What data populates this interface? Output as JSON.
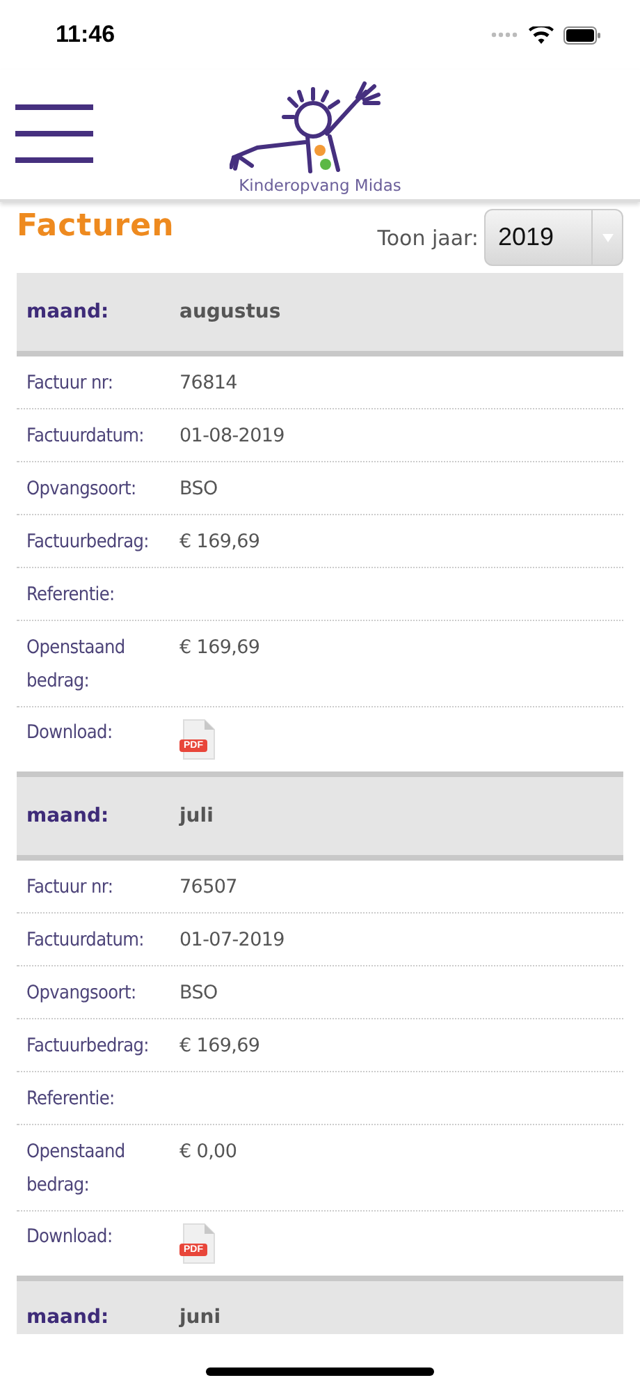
{
  "status_bar": {
    "time": "11:46"
  },
  "header": {
    "logo_text": "Kinderopvang Midas"
  },
  "page": {
    "title": "Facturen",
    "year_label": "Toon jaar:",
    "year": "2019"
  },
  "sections": [
    {
      "month_label": "maand:",
      "month": "augustus",
      "rows": [
        {
          "kind": "text",
          "label": "Factuur nr:",
          "value": "76814"
        },
        {
          "kind": "text",
          "label": "Factuurdatum:",
          "value": "01-08-2019"
        },
        {
          "kind": "text",
          "label": "Opvangsoort:",
          "value": "BSO"
        },
        {
          "kind": "text",
          "label": "Factuurbedrag:",
          "value": "€ 169,69"
        },
        {
          "kind": "text",
          "label": "Referentie:"
        },
        {
          "kind": "text",
          "label": "Openstaand bedrag:",
          "value": "€ 169,69"
        },
        {
          "kind": "pdf",
          "label": "Download:",
          "value": "PDF"
        }
      ]
    },
    {
      "month_label": "maand:",
      "month": "juli",
      "rows": [
        {
          "kind": "text",
          "label": "Factuur nr:",
          "value": "76507"
        },
        {
          "kind": "text",
          "label": "Factuurdatum:",
          "value": "01-07-2019"
        },
        {
          "kind": "text",
          "label": "Opvangsoort:",
          "value": "BSO"
        },
        {
          "kind": "text",
          "label": "Factuurbedrag:",
          "value": "€ 169,69"
        },
        {
          "kind": "text",
          "label": "Referentie:"
        },
        {
          "kind": "text",
          "label": "Openstaand bedrag:",
          "value": "€ 0,00"
        },
        {
          "kind": "pdf",
          "label": "Download:",
          "value": "PDF"
        }
      ]
    },
    {
      "month_label": "maand:",
      "month": "juni"
    }
  ]
}
